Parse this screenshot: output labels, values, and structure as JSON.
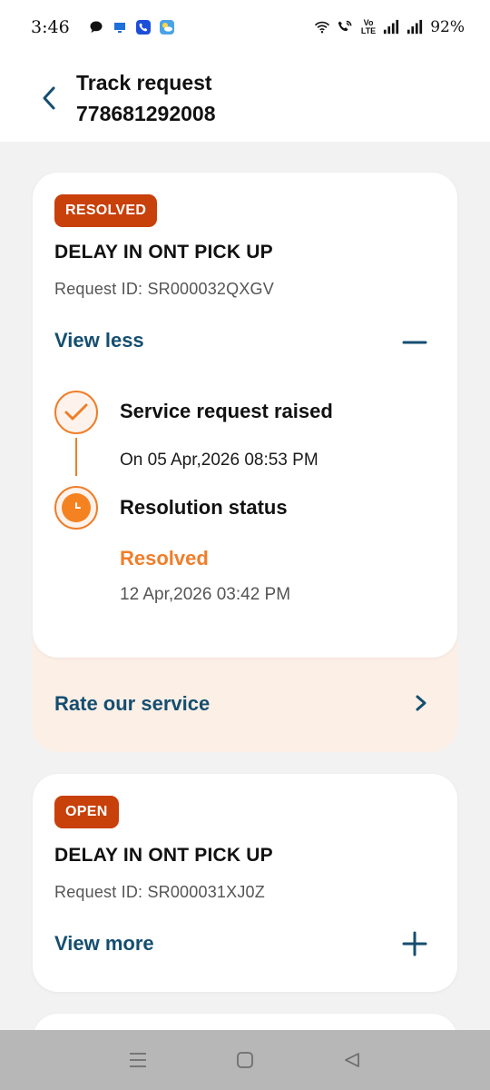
{
  "status_bar": {
    "time": "3:46",
    "volte_top": "Vo",
    "volte_bottom": "LTE",
    "battery": "92%"
  },
  "header": {
    "title": "Track request",
    "number": "778681292008"
  },
  "requests": [
    {
      "badge": "RESOLVED",
      "title": "DELAY IN ONT PICK UP",
      "request_id": "Request ID: SR000032QXGV",
      "toggle_label": "View less",
      "timeline": {
        "raised_title": "Service request raised",
        "raised_date": "On 05 Apr,2026 08:53 PM",
        "resolution_title": "Resolution status",
        "resolution_status": "Resolved",
        "resolution_date": "12 Apr,2026 03:42 PM"
      },
      "rate_label": "Rate our service"
    },
    {
      "badge": "OPEN",
      "title": "DELAY IN ONT PICK UP",
      "request_id": "Request ID: SR000031XJ0Z",
      "toggle_label": "View more"
    }
  ],
  "colors": {
    "accent": "#144e70",
    "badge": "#c8400a",
    "timeline": "#f07e2a",
    "rate_bg": "#fcefe6"
  },
  "icons": {
    "back": "chevron-left-icon",
    "collapse": "minus-icon",
    "expand": "plus-icon",
    "rate": "chevron-right-icon"
  }
}
